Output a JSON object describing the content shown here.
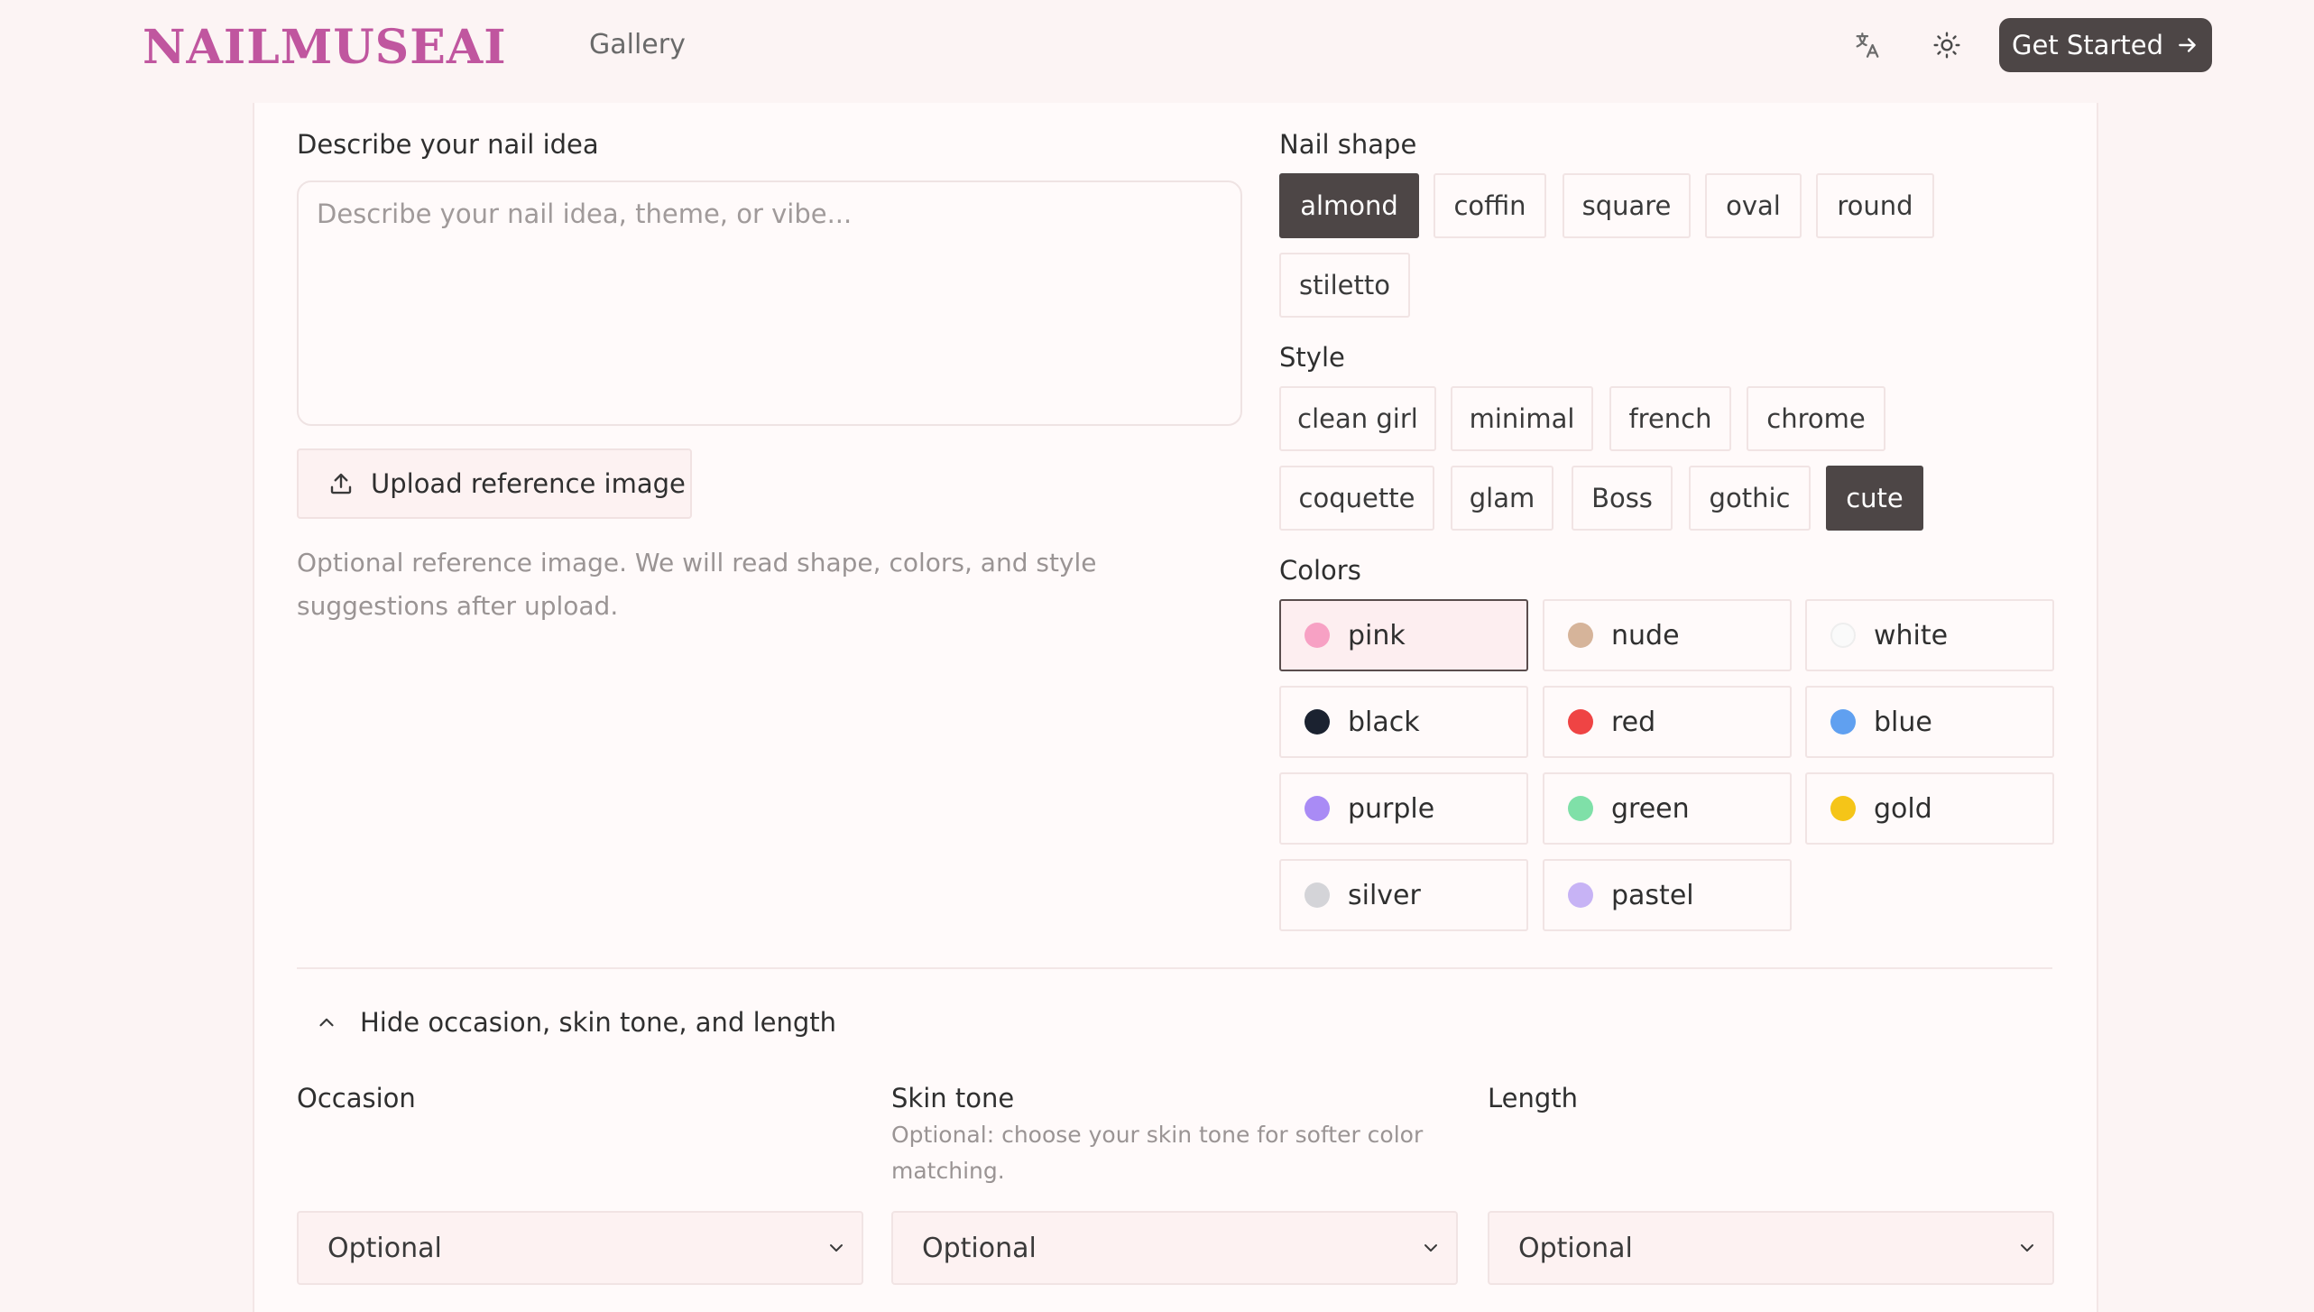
{
  "header": {
    "logo": "NAILMUSEAI",
    "nav_gallery": "Gallery",
    "translate_icon": "translate-icon",
    "theme_icon": "sun-icon",
    "cta_label": "Get Started",
    "cta_icon": "arrow-right-icon"
  },
  "idea": {
    "label": "Describe your nail idea",
    "placeholder": "Describe your nail idea, theme, or vibe...",
    "upload_label": "Upload reference image",
    "upload_icon": "upload-icon",
    "help_text": "Optional reference image. We will read shape, colors, and style suggestions after upload."
  },
  "shape": {
    "label": "Nail shape",
    "options": [
      "almond",
      "coffin",
      "square",
      "oval",
      "round",
      "stiletto"
    ],
    "selected": "almond"
  },
  "style": {
    "label": "Style",
    "options": [
      "clean girl",
      "minimal",
      "french",
      "chrome",
      "coquette",
      "glam",
      "Boss",
      "gothic",
      "cute"
    ],
    "selected": "cute"
  },
  "colors": {
    "label": "Colors",
    "options": [
      {
        "name": "pink",
        "hex": "#f7a1c4"
      },
      {
        "name": "nude",
        "hex": "#d6b49a"
      },
      {
        "name": "white",
        "hex": "#fafafa"
      },
      {
        "name": "black",
        "hex": "#1b2230"
      },
      {
        "name": "red",
        "hex": "#ef4444"
      },
      {
        "name": "blue",
        "hex": "#60a0f0"
      },
      {
        "name": "purple",
        "hex": "#a98bf5"
      },
      {
        "name": "green",
        "hex": "#7fe0a8"
      },
      {
        "name": "gold",
        "hex": "#f5c518"
      },
      {
        "name": "silver",
        "hex": "#d4d4d8"
      },
      {
        "name": "pastel",
        "hex": "#c7b3f5"
      }
    ],
    "selected": "pink"
  },
  "advanced": {
    "toggle_label": "Hide occasion, skin tone, and length",
    "toggle_icon": "chevron-up-icon",
    "occasion_label": "Occasion",
    "skin_tone_label": "Skin tone",
    "skin_tone_help": "Optional: choose your skin tone for softer color matching.",
    "length_label": "Length",
    "occasion_value": "Optional",
    "skin_tone_value": "Optional",
    "length_value": "Optional"
  },
  "theme": {
    "accent": "#c0569f",
    "dark_button": "#4d4646"
  }
}
